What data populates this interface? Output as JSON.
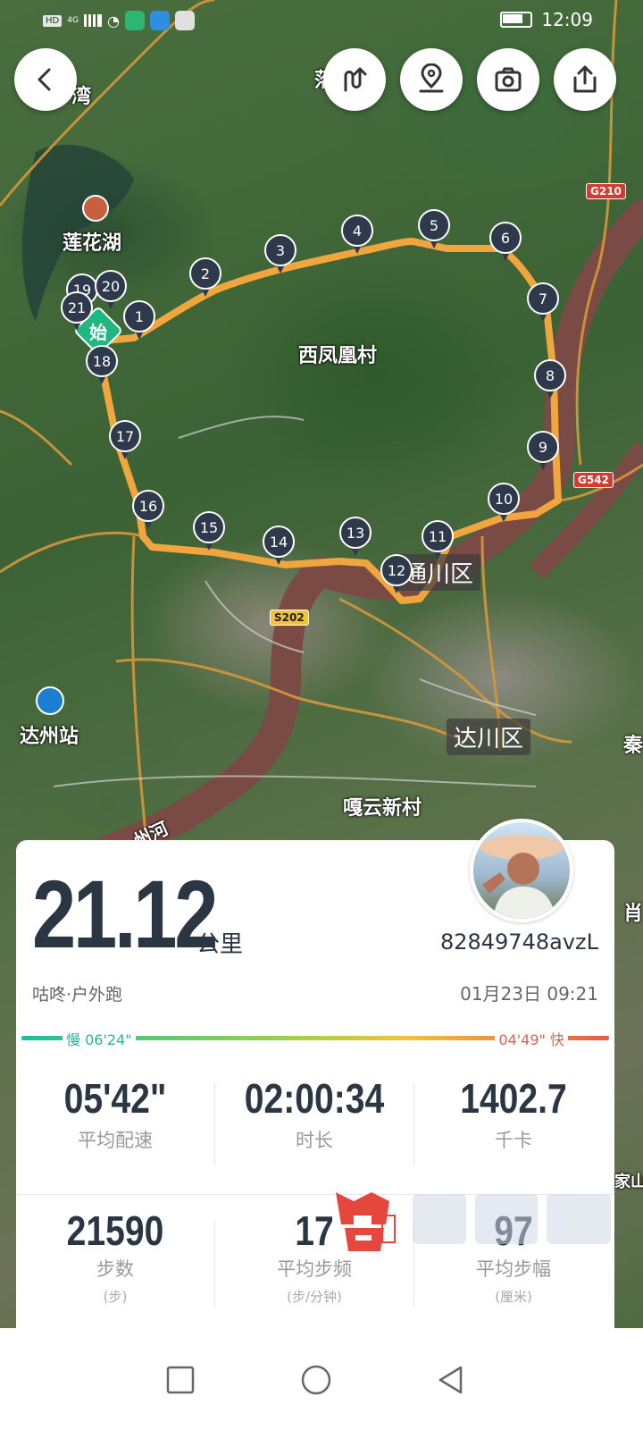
{
  "status_bar": {
    "hd": "HD",
    "network": "4G",
    "time": "12:09"
  },
  "toolbar": {
    "back_icon": "chevron-left-icon",
    "route_icon": "route-icon",
    "location_icon": "map-pin-icon",
    "camera_icon": "camera-icon",
    "share_icon": "share-icon"
  },
  "map": {
    "labels": {
      "wan": "湾",
      "lotus_lake": "莲花湖",
      "west_phoenix": "西凤凰村",
      "tongchuan": "通川区",
      "dachuan": "达川区",
      "dazhou_station": "达州站",
      "gayun": "嘎云新村",
      "river": "州河",
      "top_partial": "落",
      "right_partial_1": "秦",
      "right_partial_2": "肖",
      "right_partial_3": "家山"
    },
    "roads": {
      "g210": "G210",
      "g542": "G542",
      "s202": "S202"
    },
    "start_label": "始",
    "markers": [
      "1",
      "2",
      "3",
      "4",
      "5",
      "6",
      "7",
      "8",
      "9",
      "10",
      "11",
      "12",
      "13",
      "14",
      "15",
      "16",
      "17",
      "18",
      "19",
      "20",
      "21"
    ],
    "colors": {
      "route": "#f0a63c",
      "pin": "#2e3a4c",
      "start": "#1fb880"
    }
  },
  "workout": {
    "distance": "21.12",
    "distance_unit": "公里",
    "user_id": "82849748avzL",
    "source": "咕咚·户外跑",
    "datetime": "01月23日 09:21",
    "pace_slow": "慢 06'24\"",
    "pace_fast": "04'49\" 快",
    "stats": [
      {
        "value": "05'42\"",
        "label": "平均配速",
        "unit": ""
      },
      {
        "value": "02:00:34",
        "label": "时长",
        "unit": ""
      },
      {
        "value": "1402.7",
        "label": "千卡",
        "unit": ""
      },
      {
        "value": "21590",
        "label": "步数",
        "unit": "(步)"
      },
      {
        "value": "17",
        "label": "平均步频",
        "unit": "(步/分钟)"
      },
      {
        "value": "97",
        "label": "平均步幅",
        "unit": "(厘米)"
      }
    ]
  },
  "nav_bar": {
    "recent_icon": "square-icon",
    "home_icon": "circle-icon",
    "back_icon": "triangle-back-icon"
  }
}
